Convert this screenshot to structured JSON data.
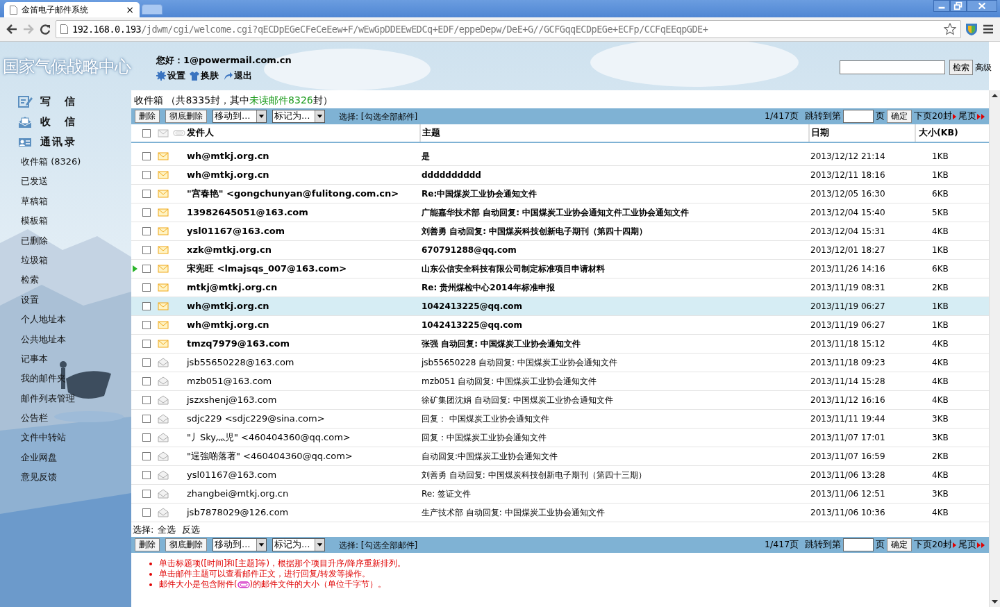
{
  "browser": {
    "tab_title": "金笛电子邮件系统",
    "tab_close": "×",
    "url_host": "192.168.0.193",
    "url_path": "/jdwm/cgi/welcome.cgi?qECDpEGeCFeCeEew+F/wEwGpDDEEwEDCq+EDF/eppeDepw/DeE+G//GCFGqqECDpEGe+ECFp/CCFqEEqpGDE+"
  },
  "header": {
    "logo": "国家气候战略中心",
    "greeting": "您好：1@powermail.com.cn",
    "links": [
      {
        "label": "设置"
      },
      {
        "label": "换肤"
      },
      {
        "label": "退出"
      }
    ],
    "search_button": "检索",
    "advanced_link": "高级"
  },
  "sidebar": {
    "actions": [
      {
        "label": "写　信"
      },
      {
        "label": "收　信"
      },
      {
        "label": "通讯录"
      }
    ],
    "folders": [
      "收件箱 (8326)",
      "已发送",
      "草稿箱",
      "模板箱",
      "已删除",
      "垃圾箱",
      "检索",
      "设置",
      "个人地址本",
      "公共地址本",
      "记事本",
      "我的邮件夹",
      "邮件列表管理",
      "公告栏",
      "文件中转站",
      "企业网盘",
      "意见反馈"
    ]
  },
  "mailbox": {
    "title_prefix": "收件箱 （共8335封，其中",
    "title_unread": "未读邮件8326",
    "title_suffix": "封）",
    "toolbars": [
      {
        "delete": "删除",
        "purge": "彻底删除",
        "move": "移动到…",
        "mark": "标记为…",
        "select_text": "选择: [勾选全部邮件]",
        "page": "1/417页",
        "jump_label": "跳转到第",
        "page_unit": "页",
        "ok": "确定",
        "next": "下页20封",
        "last": "尾页"
      },
      {
        "delete": "删除",
        "purge": "彻底删除",
        "move": "移动到…",
        "mark": "标记为…",
        "select_text": "选择: [勾选全部邮件]",
        "page": "1/417页",
        "jump_label": "跳转到第",
        "page_unit": "页",
        "ok": "确定",
        "next": "下页20封",
        "last": "尾页"
      }
    ],
    "header_checked": false,
    "columns": [
      "发件人",
      "主题",
      "日期",
      "大小(KB)"
    ],
    "rows": [
      {
        "sender": "wh@mtkj.org.cn",
        "subject": "是",
        "date": "2013/12/12 21:14",
        "size": "1KB",
        "unread": true,
        "current": false,
        "selected": false,
        "checked": false
      },
      {
        "sender": "wh@mtkj.org.cn",
        "subject": "dddddddddd",
        "date": "2013/12/11 18:16",
        "size": "1KB",
        "unread": true,
        "current": false,
        "selected": false,
        "checked": false
      },
      {
        "sender": "\"宫春艳\" <gongchunyan@fulitong.com.cn>",
        "subject": "Re:中国煤炭工业协会通知文件",
        "date": "2013/12/05 16:30",
        "size": "6KB",
        "unread": true,
        "current": false,
        "selected": false,
        "checked": false
      },
      {
        "sender": "13982645051@163.com",
        "subject": "广能嘉华技术部 自动回复: 中国煤炭工业协会通知文件工业协会通知文件",
        "date": "2013/12/04 15:40",
        "size": "5KB",
        "unread": true,
        "current": false,
        "selected": false,
        "checked": false
      },
      {
        "sender": "ysl01167@163.com",
        "subject": "刘善勇 自动回复: 中国煤炭科技创新电子期刊（第四十四期）",
        "date": "2013/12/04 15:31",
        "size": "4KB",
        "unread": true,
        "current": false,
        "selected": false,
        "checked": false
      },
      {
        "sender": "xzk@mtkj.org.cn",
        "subject": "670791288@qq.com",
        "date": "2013/12/01 18:27",
        "size": "1KB",
        "unread": true,
        "current": false,
        "selected": false,
        "checked": false
      },
      {
        "sender": "宋宪旺 <lmajsqs_007@163.com>",
        "subject": "山东公信安全科技有限公司制定标准项目申请材料",
        "date": "2013/11/26 14:16",
        "size": "6KB",
        "unread": true,
        "current": true,
        "selected": false,
        "checked": false
      },
      {
        "sender": "mtkj@mtkj.org.cn",
        "subject": "Re: 贵州煤检中心2014年标准申报",
        "date": "2013/11/19 08:31",
        "size": "2KB",
        "unread": true,
        "current": false,
        "selected": false,
        "checked": false
      },
      {
        "sender": "wh@mtkj.org.cn",
        "subject": "1042413225@qq.com",
        "date": "2013/11/19 06:27",
        "size": "1KB",
        "unread": true,
        "current": false,
        "selected": true,
        "checked": false
      },
      {
        "sender": "wh@mtkj.org.cn",
        "subject": "1042413225@qq.com",
        "date": "2013/11/19 06:27",
        "size": "1KB",
        "unread": true,
        "current": false,
        "selected": false,
        "checked": false
      },
      {
        "sender": "tmzq7979@163.com",
        "subject": "张强 自动回复: 中国煤炭工业协会通知文件",
        "date": "2013/11/18 15:12",
        "size": "4KB",
        "unread": true,
        "current": false,
        "selected": false,
        "checked": false
      },
      {
        "sender": "jsb55650228@163.com",
        "subject": "jsb55650228 自动回复: 中国煤炭工业协会通知文件",
        "date": "2013/11/18 09:23",
        "size": "4KB",
        "unread": false,
        "current": false,
        "selected": false,
        "checked": false
      },
      {
        "sender": "mzb051@163.com",
        "subject": "mzb051 自动回复: 中国煤炭工业协会通知文件",
        "date": "2013/11/14 15:28",
        "size": "4KB",
        "unread": false,
        "current": false,
        "selected": false,
        "checked": false
      },
      {
        "sender": "jszxshenj@163.com",
        "subject": "徐矿集团沈娟 自动回复: 中国煤炭工业协会通知文件",
        "date": "2013/11/12 16:16",
        "size": "4KB",
        "unread": false,
        "current": false,
        "selected": false,
        "checked": false
      },
      {
        "sender": "sdjc229 <sdjc229@sina.com>",
        "subject": "回复： 中国煤炭工业协会通知文件",
        "date": "2013/11/11 19:44",
        "size": "3KB",
        "unread": false,
        "current": false,
        "selected": false,
        "checked": false
      },
      {
        "sender": "\"丿Sky灬児\" <460404360@qq.com>",
        "subject": "回复：中国煤炭工业协会通知文件",
        "date": "2013/11/07 17:01",
        "size": "3KB",
        "unread": false,
        "current": false,
        "selected": false,
        "checked": false
      },
      {
        "sender": "\"逞強啲落著\" <460404360@qq.com>",
        "subject": "自动回复:中国煤炭工业协会通知文件",
        "date": "2013/11/07 16:59",
        "size": "2KB",
        "unread": false,
        "current": false,
        "selected": false,
        "checked": false
      },
      {
        "sender": "ysl01167@163.com",
        "subject": "刘善勇 自动回复: 中国煤炭科技创新电子期刊（第四十三期）",
        "date": "2013/11/06 13:28",
        "size": "4KB",
        "unread": false,
        "current": false,
        "selected": false,
        "checked": false
      },
      {
        "sender": "zhangbei@mtkj.org.cn",
        "subject": "Re: 签证文件",
        "date": "2013/11/06 12:51",
        "size": "3KB",
        "unread": false,
        "current": false,
        "selected": false,
        "checked": false
      },
      {
        "sender": "jsb7878029@126.com",
        "subject": "生产技术部 自动回复: 中国煤炭工业协会通知文件",
        "date": "2013/11/06 10:36",
        "size": "4KB",
        "unread": false,
        "current": false,
        "selected": false,
        "checked": false
      }
    ],
    "select_label": "选择:",
    "select_all": "全选",
    "invert": "反选",
    "notes": [
      {
        "text": "单击标题项([时间]和[主题]等)，根据那个项目升序/降序重新排列。"
      },
      {
        "text": "单击邮件主题可以查看邮件正文，进行回复/转发等操作。"
      },
      {
        "text": "邮件大小是包含附件(",
        "after": ")的邮件文件的大小（单位千字节）。"
      }
    ]
  }
}
